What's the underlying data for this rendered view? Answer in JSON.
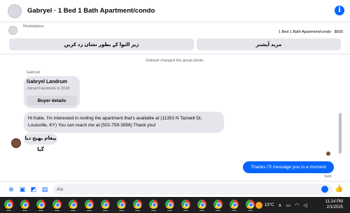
{
  "header": {
    "title": "Gabryel · 1 Bed 1 Bath Apartment/condo",
    "info_icon": "info-icon"
  },
  "marketplace": {
    "label": "Marketplace",
    "listing": "1 Bed 1 Bath Apartment/condo · $600",
    "btn_left": "زیر التوا کے بطور نشان زد کریں",
    "btn_right": "مزید آپشنز"
  },
  "thread": {
    "system_message": "Gabryel changed the group photo.",
    "sender_name": "Gabryel",
    "profile_card": {
      "name": "Gabryel Landrum",
      "joined": "Joined Facebook in 2018",
      "button": "Buyer details"
    },
    "incoming_message": "Hi Katie, I'm interested in renting the apartment that's available at (11353 N Tazwell Dr, Louisville, KY) You can reach me at (502-759-3956) Thank you!",
    "incoming_status": "پیغام بھیج دیا گیا",
    "outgoing_message": "Thanks i\"ll message you in a moment",
    "sent_label": "Sent"
  },
  "composer": {
    "placeholder": "Aa"
  },
  "taskbar": {
    "temperature": "13°C",
    "time": "11:14 PM",
    "date": "2/1/2025",
    "app_count": 16
  },
  "colors": {
    "accent": "#0866ff",
    "bubble_in": "#e4e6eb",
    "taskbar": "#1f1f1f"
  }
}
